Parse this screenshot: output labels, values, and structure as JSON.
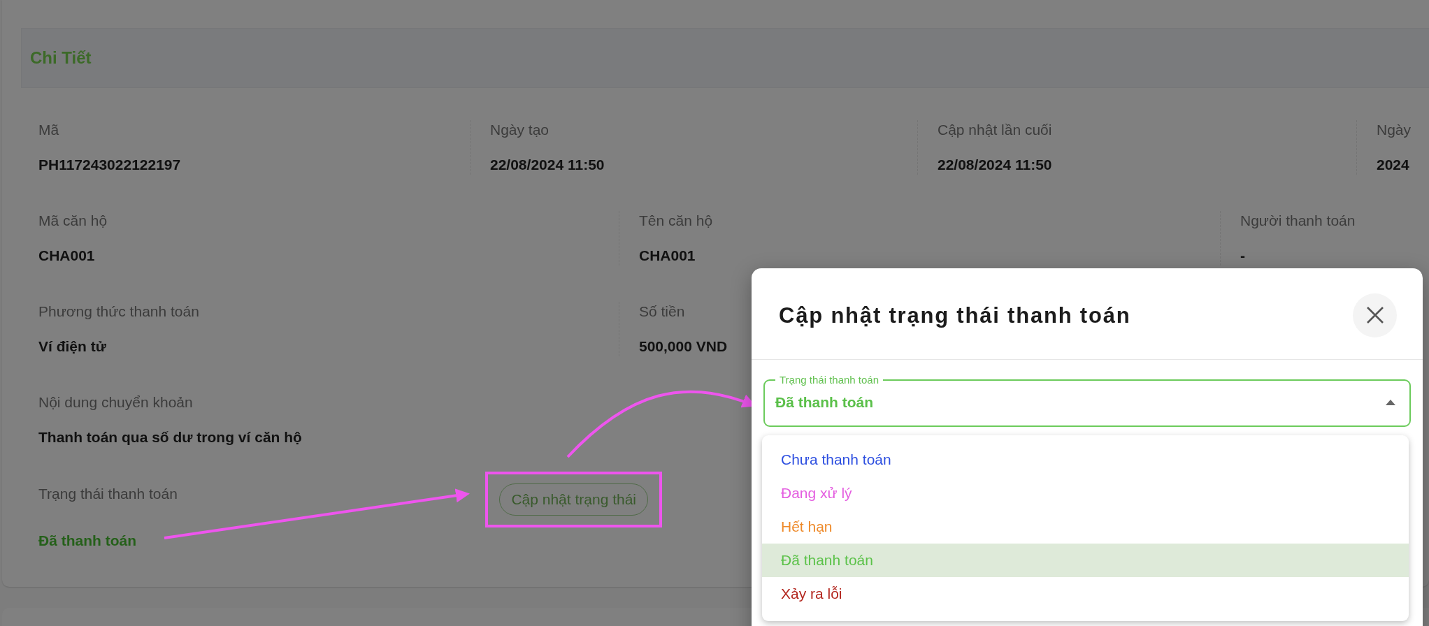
{
  "section_title": "Chi Tiết",
  "field_rows": [
    [
      {
        "label": "Mã",
        "value": "PH117243022122197"
      },
      {
        "label": "Ngày tạo",
        "value": "22/08/2024 11:50"
      },
      {
        "label": "Cập nhật lần cuối",
        "value": "22/08/2024 11:50"
      },
      {
        "label": "Ngày",
        "value": "2024"
      }
    ],
    [
      {
        "label": "Mã căn hộ",
        "value": "CHA001"
      },
      {
        "label": "Tên căn hộ",
        "value": "CHA001"
      },
      {
        "label": "Người thanh toán",
        "value": "-"
      }
    ],
    [
      {
        "label": "Phương thức thanh toán",
        "value": "Ví điện tử"
      },
      {
        "label": "Số tiền",
        "value": "500,000 VND"
      }
    ],
    [
      {
        "label": "Nội dung chuyển khoản",
        "value": "Thanh toán qua số dư trong ví căn hộ"
      }
    ]
  ],
  "payment_status": {
    "label": "Trạng thái thanh toán",
    "button": "Cập nhật trạng thái",
    "value": "Đã thanh toán"
  },
  "dialog": {
    "title": "Cập nhật trạng thái thanh toán",
    "select": {
      "label": "Trạng thái thanh toán",
      "value": "Đã thanh toán",
      "expanded": true
    },
    "options": [
      {
        "label": "Chưa thanh toán",
        "color": "#2d4fe0",
        "selected": false
      },
      {
        "label": "Đang xử lý",
        "color": "#e45ee0",
        "selected": false
      },
      {
        "label": "Hết hạn",
        "color": "#ee8a2a",
        "selected": false
      },
      {
        "label": "Đã thanh toán",
        "color": "#5cc24a",
        "selected": true
      },
      {
        "label": "Xảy ra lỗi",
        "color": "#b3261e",
        "selected": false
      }
    ]
  }
}
